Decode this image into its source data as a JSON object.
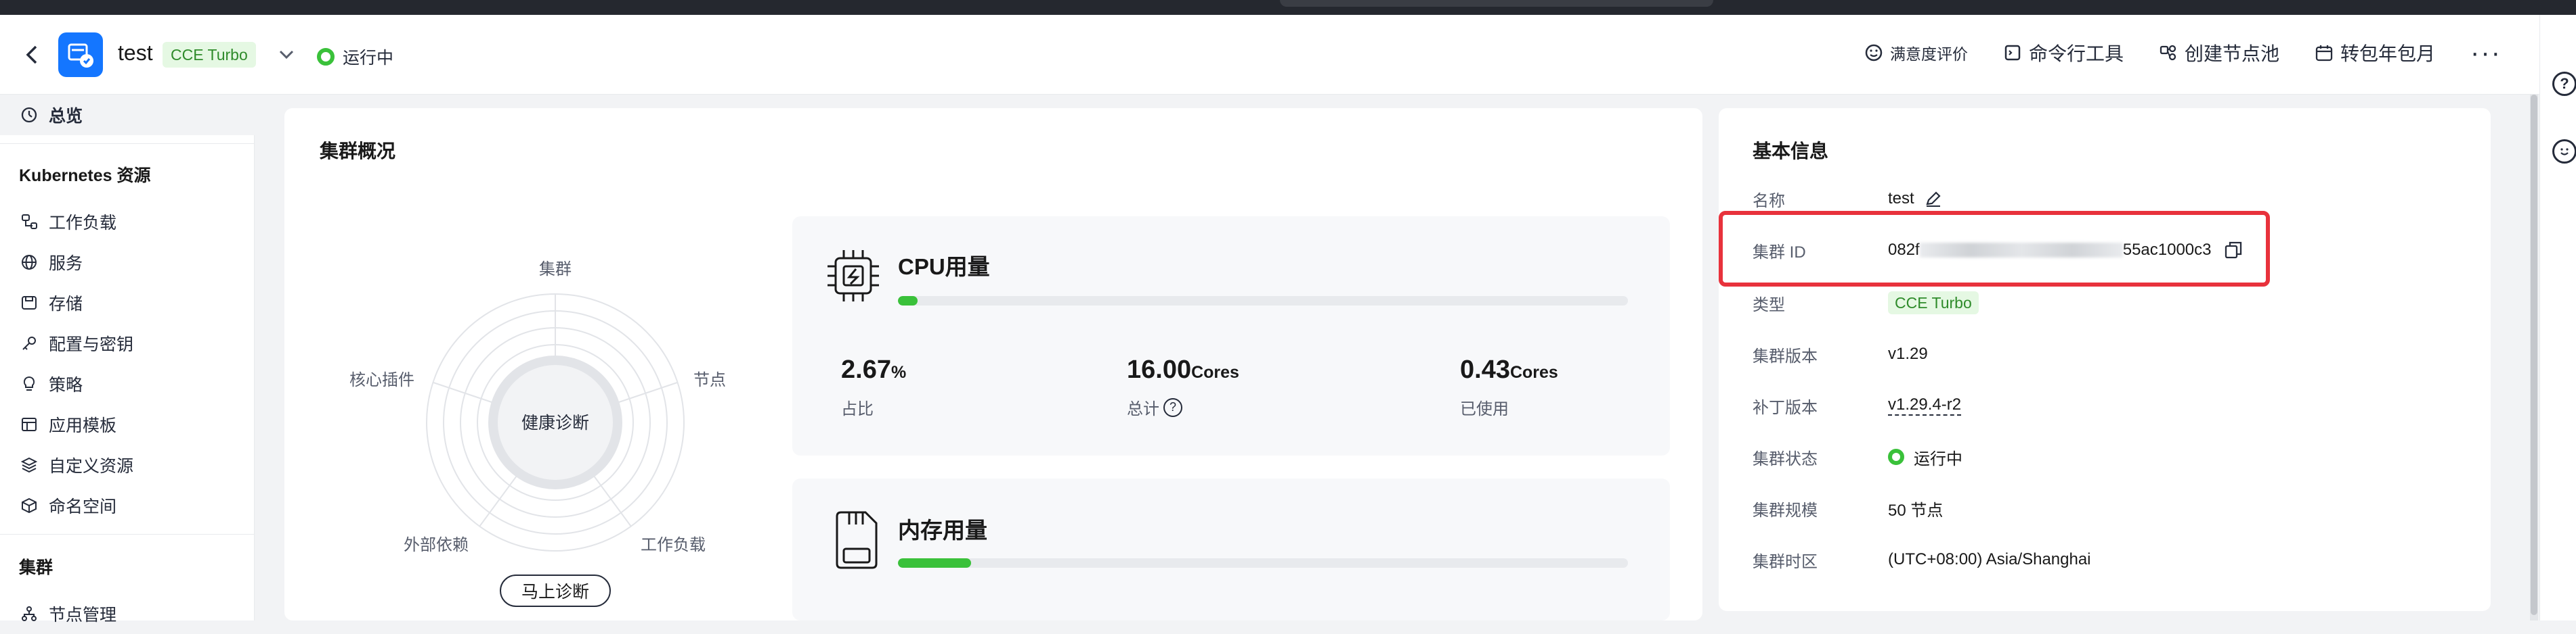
{
  "header": {
    "cluster_name": "test",
    "type_tag": "CCE Turbo",
    "status": "运行中",
    "actions": {
      "feedback": "满意度评价",
      "cli": "命令行工具",
      "create_pool": "创建节点池",
      "billing": "转包年包月",
      "more": "···"
    }
  },
  "sidebar": {
    "overview": "总览",
    "k8s_section": "Kubernetes 资源",
    "items": [
      "工作负载",
      "服务",
      "存储",
      "配置与密钥",
      "策略",
      "应用模板",
      "自定义资源",
      "命名空间"
    ],
    "cluster_section": "集群",
    "node_mgmt": "节点管理"
  },
  "overview": {
    "title": "集群概况",
    "radar": {
      "center": "健康诊断",
      "labels": [
        "集群",
        "节点",
        "工作负载",
        "外部依赖",
        "核心插件"
      ]
    },
    "diagnose_button": "马上诊断",
    "cpu": {
      "title": "CPU用量",
      "progress": 0.027,
      "ratio_value": "2.67",
      "ratio_unit": "%",
      "ratio_label": "占比",
      "total_value": "16.00",
      "total_unit": "Cores",
      "total_label": "总计",
      "used_value": "0.43",
      "used_unit": "Cores",
      "used_label": "已使用"
    },
    "memory": {
      "title": "内存用量",
      "progress": 0.1
    }
  },
  "basic_info": {
    "title": "基本信息",
    "name_key": "名称",
    "name_val": "test",
    "id_key": "集群 ID",
    "id_prefix": "082f",
    "id_suffix": "55ac1000c3",
    "type_key": "类型",
    "type_val": "CCE Turbo",
    "version_key": "集群版本",
    "version_val": "v1.29",
    "patch_key": "补丁版本",
    "patch_val": "v1.29.4-r2",
    "status_key": "集群状态",
    "status_val": "运行中",
    "scale_key": "集群规模",
    "scale_val": "50 节点",
    "tz_key": "集群时区",
    "tz_val": "(UTC+08:00) Asia/Shanghai"
  },
  "colors": {
    "accent": "#1476ff",
    "running": "#3ac13a",
    "highlight": "#e8323c",
    "tag_bg": "#e5f8e3",
    "tag_text": "#2e8b2a"
  }
}
